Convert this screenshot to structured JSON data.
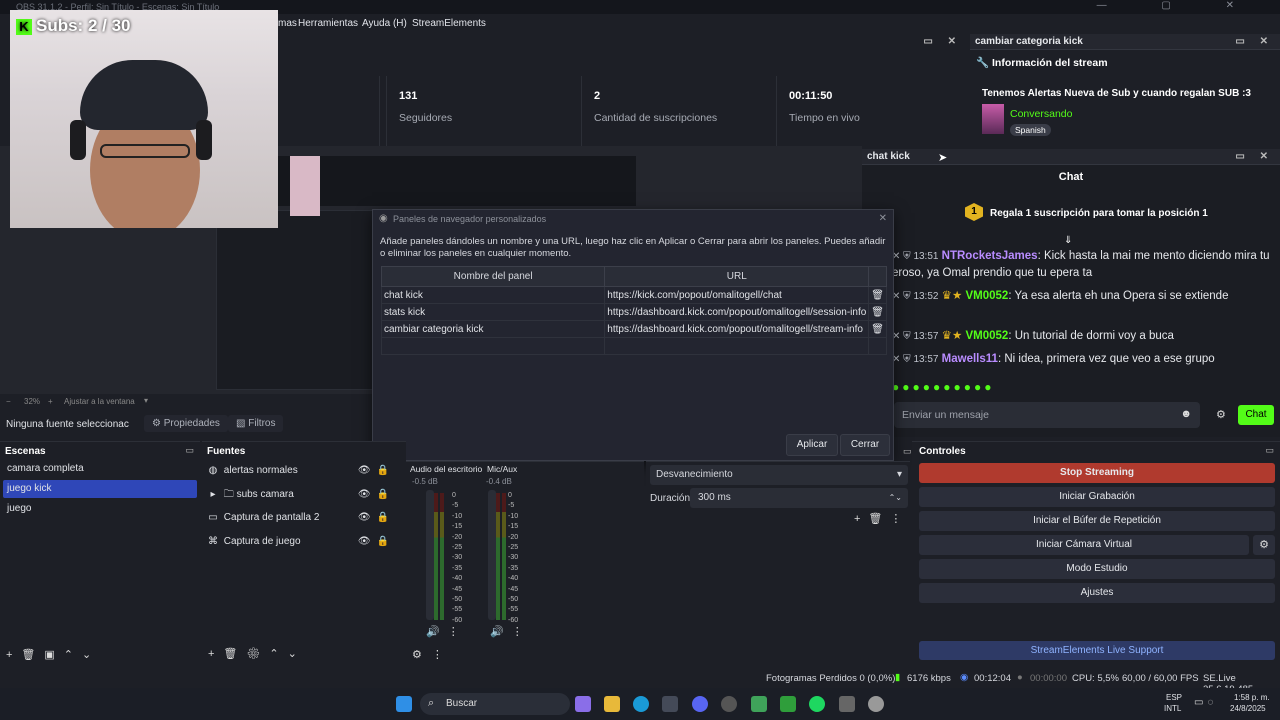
{
  "window": {
    "title": "OBS 31.1.2 - Perfil: Sin Título - Escenas: Sin Título",
    "controls": "— ▢ ✕"
  },
  "menu": {
    "items": [
      "mas",
      "Herramientas",
      "Ayuda (H)",
      "StreamElements"
    ]
  },
  "camera": {
    "overlay_text": "Subs: 2 / 30"
  },
  "stats_dock": {
    "title": "st",
    "stats": [
      {
        "value": "131",
        "label": "Seguidores"
      },
      {
        "value": "2",
        "label": "Cantidad de suscripciones"
      },
      {
        "value": "00:11:50",
        "label": "Tiempo en vivo"
      }
    ]
  },
  "info_dock": {
    "title": "cambiar categoria kick",
    "heading": "Información del stream",
    "stream_title": "Tenemos Alertas Nueva de Sub y cuando regalan SUB :3",
    "category": "Conversando",
    "language": "Spanish"
  },
  "chat_dock": {
    "title": "chat kick",
    "header": "Chat",
    "pinned_badge": "1",
    "pinned": "Regala 1 suscripción para tomar la posición 1",
    "messages": [
      {
        "time": "13:51",
        "user": "NTRocketsJames",
        "text": ": Kick hasta la mai me mento diciendo mira tu",
        "cont": "eroso, ya Omal prendio que tu epera ta",
        "color": "#b98cff"
      },
      {
        "time": "13:52",
        "user": "VM0052",
        "text": ": Ya esa alerta eh una Opera si se extiende",
        "color": "#53fc18"
      },
      {
        "time": "13:57",
        "user": "VM0052",
        "text": ": Un tutorial de dormi voy a buca",
        "color": "#53fc18"
      },
      {
        "time": "13:57",
        "user": "Mawells11",
        "text": ": Ni idea, primera vez que veo a ese grupo",
        "color": "#b98cff"
      }
    ],
    "input_placeholder": "Enviar un mensaje",
    "send_label": "Chat"
  },
  "preview": {
    "zoom": "32%",
    "fit_label": "Ajustar a la ventana"
  },
  "source_bar": {
    "none_selected": "Ninguna fuente seleccionac",
    "properties": "Propiedades",
    "filters": "Filtros"
  },
  "dialog": {
    "title": "Paneles de navegador personalizados",
    "description": "Añade paneles dándoles un nombre y una URL, luego haz clic en Aplicar o Cerrar para abrir los paneles. Puedes añadir o eliminar los paneles en cualquier momento.",
    "col_name": "Nombre del panel",
    "col_url": "URL",
    "rows": [
      {
        "name": "chat kick",
        "url": "https://kick.com/popout/omalitogell/chat"
      },
      {
        "name": "stats kick",
        "url": "https://dashboard.kick.com/popout/omalitogell/session-info"
      },
      {
        "name": "cambiar categoria kick",
        "url": "https://dashboard.kick.com/popout/omalitogell/stream-info"
      }
    ],
    "apply": "Aplicar",
    "close": "Cerrar"
  },
  "scenes": {
    "title": "Escenas",
    "items": [
      "camara completa",
      "juego kick",
      "juego"
    ],
    "selected": 1
  },
  "sources": {
    "title": "Fuentes",
    "items": [
      "alertas normales",
      "subs camara",
      "Captura de pantalla 2",
      "Captura de juego"
    ]
  },
  "mixer": {
    "channels": [
      {
        "name": "Audio del escritorio",
        "db": "-0.5 dB"
      },
      {
        "name": "Mic/Aux",
        "db": "-0.4 dB"
      }
    ],
    "scale": [
      "0",
      "-5",
      "-10",
      "-15",
      "-20",
      "-25",
      "-30",
      "-35",
      "-40",
      "-45",
      "-50",
      "-55",
      "-60"
    ]
  },
  "transitions": {
    "type": "Desvanecimiento",
    "duration_label": "Duración",
    "duration": "300 ms"
  },
  "controls": {
    "title": "Controles",
    "stop": "Stop Streaming",
    "record": "Iniciar Grabación",
    "replay": "Iniciar el Búfer de Repetición",
    "vcam": "Iniciar Cámara Virtual",
    "studio": "Modo Estudio",
    "settings": "Ajustes",
    "support": "StreamElements Live Support"
  },
  "status": {
    "dropped": "Fotogramas Perdidos 0 (0,0%)",
    "bitrate": "6176 kbps",
    "live_time": "00:12:04",
    "rec_time": "00:00:00",
    "cpu": "CPU: 5,5%",
    "fps": "60,00 / 60,00 FPS",
    "version": "SE.Live 25.6.19.485"
  },
  "taskbar": {
    "search": "Buscar",
    "lang": "ESP",
    "layout": "INTL",
    "time": "1:58 p. m.",
    "date": "24/8/2025"
  },
  "colors": {
    "accent": "#53fc18",
    "stop": "#b03a2e",
    "selected": "#2f47b8"
  }
}
